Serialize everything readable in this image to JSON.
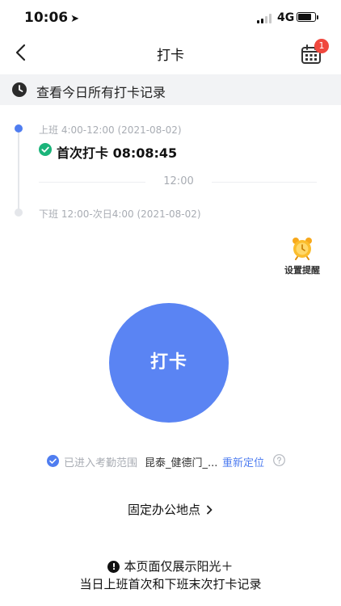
{
  "status_bar": {
    "time": "10:06",
    "network": "4G"
  },
  "nav": {
    "title": "打卡",
    "notification_count": "1"
  },
  "banner": {
    "text": "查看今日所有打卡记录"
  },
  "timeline": {
    "shift_on": "上班 4:00-12:00 (2021-08-02)",
    "first_punch": "首次打卡 08:08:45",
    "divider_time": "12:00",
    "shift_off": "下班 12:00-次日4:00 (2021-08-02)"
  },
  "reminder": {
    "label": "设置提醒"
  },
  "punch_button": {
    "label": "打卡"
  },
  "location": {
    "status": "已进入考勤范围",
    "place": "昆泰_健德门_...",
    "relocate": "重新定位"
  },
  "office": {
    "label": "固定办公地点"
  },
  "notice": {
    "line1": "本页面仅展示阳光＋",
    "line2": "当日上班首次和下班末次打卡记录"
  },
  "colors": {
    "accent": "#5a84f3",
    "success": "#1bb47a",
    "badge": "#f0483e"
  }
}
